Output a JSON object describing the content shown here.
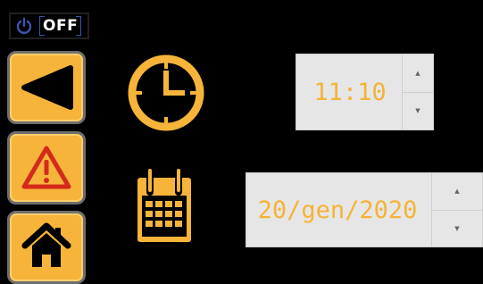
{
  "power": {
    "label": "OFF",
    "icon": "power-icon",
    "state": "off"
  },
  "sidebar": {
    "items": [
      {
        "name": "back",
        "icon": "back-triangle-icon"
      },
      {
        "name": "alarm",
        "icon": "warning-icon"
      },
      {
        "name": "home",
        "icon": "home-icon"
      }
    ]
  },
  "time": {
    "value": "11:10",
    "up": "▲",
    "down": "▼",
    "icon": "clock-icon"
  },
  "date": {
    "value": "20/gen/2020",
    "up": "▲",
    "down": "▼",
    "icon": "calendar-icon"
  },
  "colors": {
    "accent": "#f6b43a",
    "background": "#000000",
    "field": "#e6e6e6",
    "warning": "#d42a1c"
  }
}
